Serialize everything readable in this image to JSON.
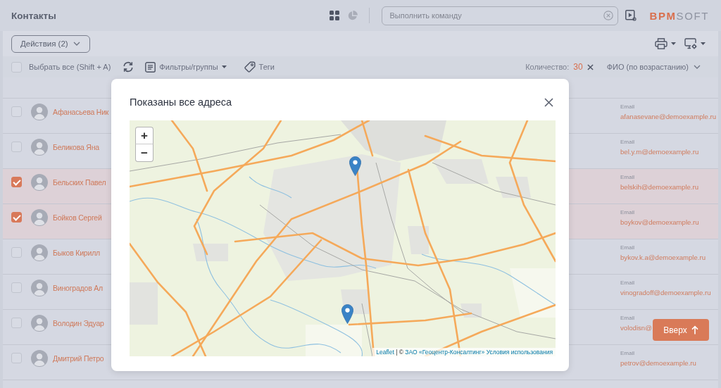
{
  "header": {
    "title": "Контакты",
    "command_search": {
      "placeholder": "Выполнить команду"
    },
    "logo": {
      "primary": "BPM",
      "secondary": "SOFT"
    }
  },
  "actions_bar": {
    "actions_button": "Действия (2)"
  },
  "list_toolbar": {
    "select_all": {
      "label": "Выбрать все (Shift + A)",
      "checked": false
    },
    "filters_button": "Фильтры/группы",
    "tags_button": "Теги",
    "count_label": "Количество:",
    "count": "30",
    "sort_button": "ФИО (по возрастанию)"
  },
  "contacts": [
    {
      "name": "Афанасьева Ник",
      "email_label": "Email",
      "email": "afanasevane@demoexample.ru",
      "selected": false
    },
    {
      "name": "Беликова Яна",
      "email_label": "Email",
      "email": "bel.y.m@demoexample.ru",
      "selected": false
    },
    {
      "name": "Бельских Павел",
      "email_label": "Email",
      "email": "belskih@demoexample.ru",
      "selected": true
    },
    {
      "name": "Бойков Сергей",
      "email_label": "Email",
      "email": "boykov@demoexample.ru",
      "selected": true
    },
    {
      "name": "Быков Кирилл",
      "email_label": "Email",
      "email": "bykov.k.a@demoexample.ru",
      "selected": false
    },
    {
      "name": "Виноградов Ал",
      "email_label": "Email",
      "email": "vinogradoff@demoexample.ru",
      "selected": false
    },
    {
      "name": "Володин Эдуар",
      "email_label": "Email",
      "email": "volodisn@",
      "selected": false
    },
    {
      "name": "Дмитрий Петро",
      "email_label": "Email",
      "email": "petrov@demoexample.ru",
      "selected": false
    }
  ],
  "scroll_top_button": "Вверх",
  "dialog": {
    "title": "Показаны все адреса",
    "map": {
      "zoom_in": "+",
      "zoom_out": "−",
      "attribution": {
        "library_link": "Leaflet",
        "separator": "| ©",
        "provider_link": "ЗАО «Геоцентр-Консалтинг»",
        "terms_link": "Условия использования"
      }
    }
  }
}
